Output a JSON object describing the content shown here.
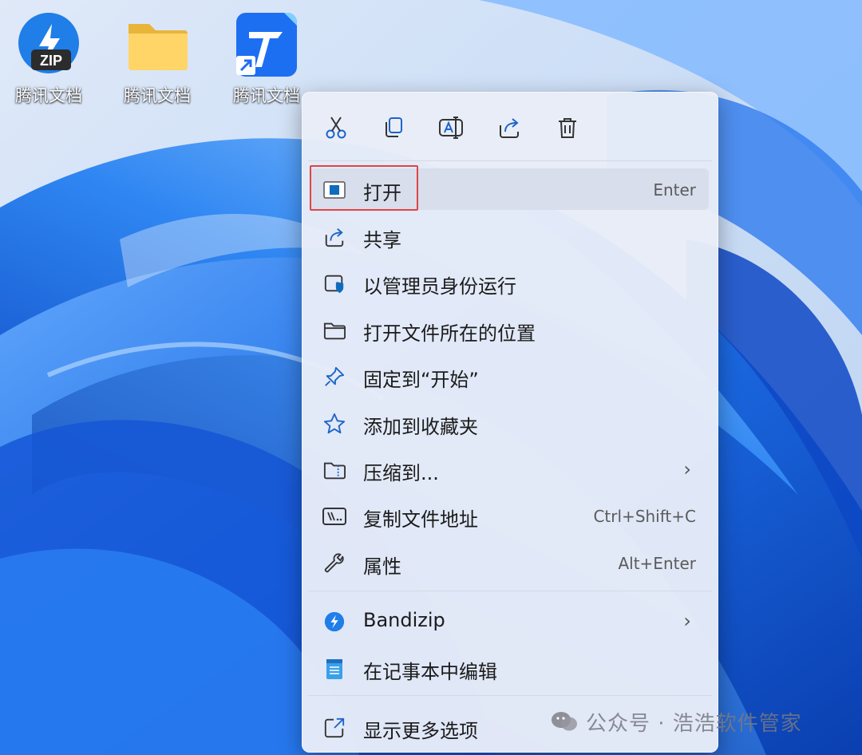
{
  "desktop": {
    "icons": [
      {
        "label": "腾讯文档",
        "icon": "zip-archive-icon",
        "badge": "ZIP"
      },
      {
        "label": "腾讯文档",
        "icon": "folder-icon"
      },
      {
        "label": "腾讯文档",
        "icon": "tencent-docs-shortcut-icon"
      }
    ]
  },
  "context_menu": {
    "toolbar": [
      {
        "name": "cut",
        "icon": "scissors-icon"
      },
      {
        "name": "copy",
        "icon": "copy-icon"
      },
      {
        "name": "rename",
        "icon": "rename-icon"
      },
      {
        "name": "share",
        "icon": "share-icon"
      },
      {
        "name": "delete",
        "icon": "trash-icon"
      }
    ],
    "items": [
      {
        "label": "打开",
        "shortcut": "Enter",
        "icon": "open-window-icon",
        "highlighted": true
      },
      {
        "label": "共享",
        "icon": "share-icon"
      },
      {
        "label": "以管理员身份运行",
        "icon": "admin-shield-icon"
      },
      {
        "label": "打开文件所在的位置",
        "icon": "folder-outline-icon"
      },
      {
        "label": "固定到“开始”",
        "icon": "pin-icon"
      },
      {
        "label": "添加到收藏夹",
        "icon": "star-icon"
      },
      {
        "label": "压缩到...",
        "icon": "zip-folder-icon",
        "submenu": true
      },
      {
        "label": "复制文件地址",
        "shortcut": "Ctrl+Shift+C",
        "icon": "path-icon"
      },
      {
        "label": "属性",
        "shortcut": "Alt+Enter",
        "icon": "wrench-icon"
      },
      {
        "label": "Bandizip",
        "icon": "bandizip-icon",
        "submenu": true
      },
      {
        "label": "在记事本中编辑",
        "icon": "notepad-icon"
      },
      {
        "label": "显示更多选项",
        "icon": "more-options-icon"
      }
    ],
    "submenu_glyph": "›"
  },
  "watermark": {
    "text": "公众号 · 浩浩软件管家"
  },
  "colors": {
    "accent": "#0f6cbd",
    "highlight_border": "#e04444",
    "menu_bg": "#e9edf8"
  }
}
